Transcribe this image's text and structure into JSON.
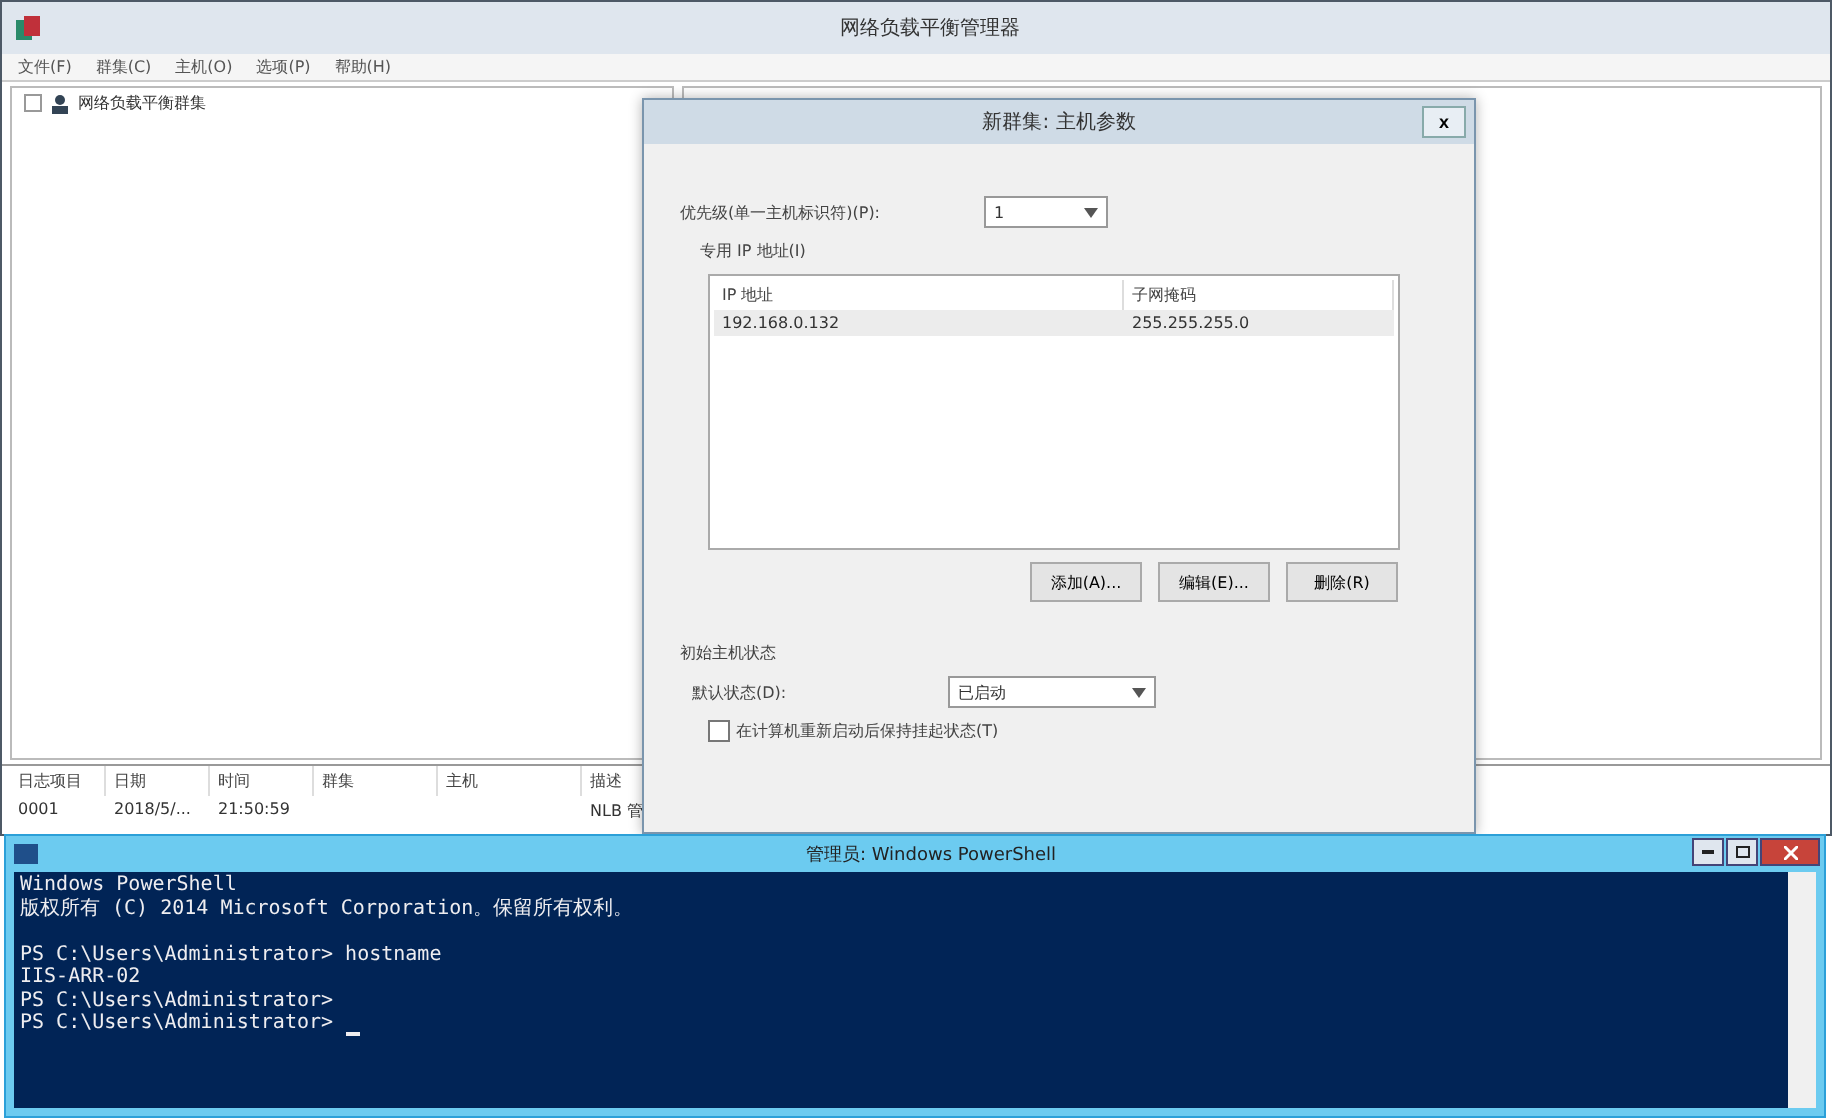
{
  "main_window": {
    "title": "网络负载平衡管理器",
    "menu": [
      "文件(F)",
      "群集(C)",
      "主机(O)",
      "选项(P)",
      "帮助(H)"
    ],
    "tree": [
      {
        "label": "网络负载平衡群集",
        "expanded": false
      }
    ],
    "log": {
      "columns": [
        "日志项目",
        "日期",
        "时间",
        "群集",
        "主机",
        "描述"
      ],
      "rows": [
        {
          "entry": "0001",
          "date": "2018/5/...",
          "time": "21:50:59",
          "description": "NLB 管"
        }
      ]
    }
  },
  "dialog": {
    "title": "新群集: 主机参数",
    "close": "x",
    "priority_label": "优先级(单一主机标识符)(P):",
    "priority_value": "1",
    "ip_section": "专用 IP 地址(I)",
    "ip_columns": [
      "IP 地址",
      "子网掩码"
    ],
    "ip_rows": [
      {
        "cells": [
          "192.168.0.132",
          "255.255.255.0"
        ],
        "selected": true
      }
    ],
    "buttons": [
      "添加(A)...",
      "编辑(E)...",
      "删除(R)"
    ],
    "state_section": "初始主机状态",
    "state_label": "默认状态(D):",
    "state_value": "已启动",
    "checkbox": {
      "label": "在计算机重新启动后保持挂起状态(T)",
      "checked": false
    }
  },
  "powershell": {
    "title": "管理员: Windows PowerShell",
    "blocks": [
      [
        "Windows PowerShell",
        "版权所有 (C) 2014 Microsoft Corporation。保留所有权利。"
      ],
      [
        "PS C:\\Users\\Administrator> hostname",
        "IIS-ARR-02",
        "PS C:\\Users\\Administrator>",
        "PS C:\\Users\\Administrator>"
      ]
    ]
  }
}
